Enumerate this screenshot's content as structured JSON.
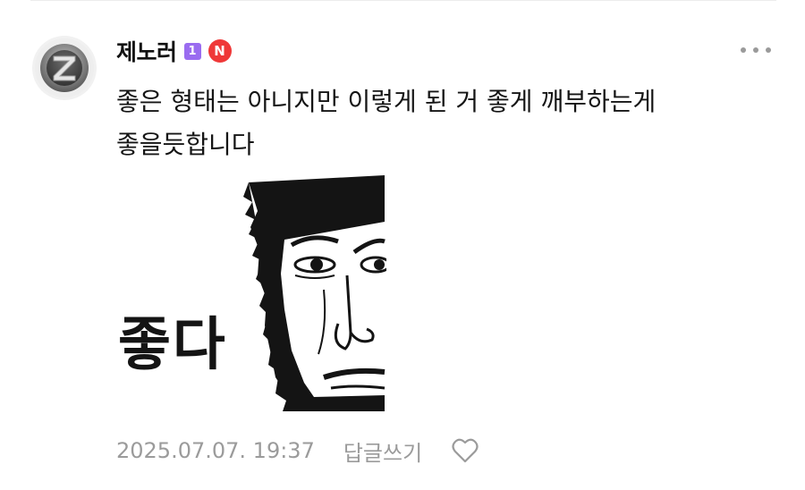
{
  "comment": {
    "author": "제노러",
    "level_badge": "1",
    "new_badge": "N",
    "text_line1": "좋은 형태는 아니지만 이렇게 된 거 좋게 깨부하는게",
    "text_line2": "좋을듯합니다",
    "sticker_text": "좋다",
    "timestamp": "2025.07.07. 19:37",
    "reply_label": "답글쓰기"
  },
  "icons": {
    "avatar": "z-logo-avatar",
    "more": "more-dots-icon",
    "like": "heart-outline-icon"
  },
  "colors": {
    "level_badge": "#9a6cf0",
    "new_badge": "#ef3838",
    "meta_text": "#9b9b9b"
  }
}
